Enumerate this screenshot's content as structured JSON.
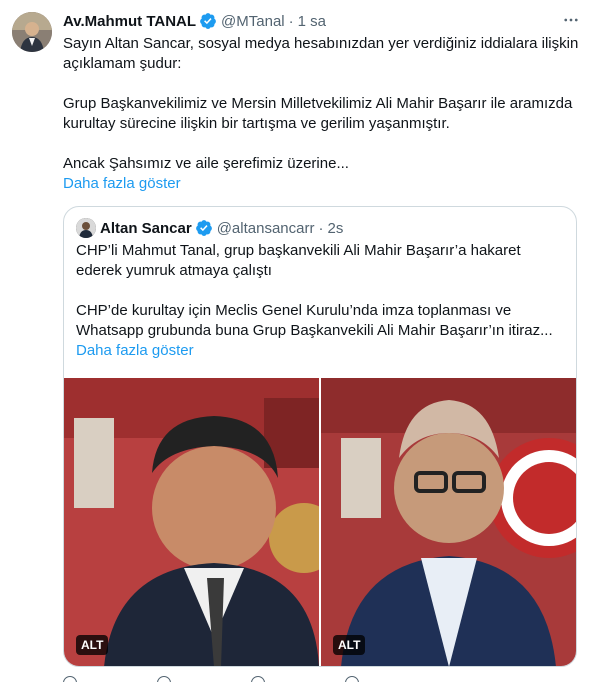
{
  "tweet": {
    "author_name": "Av.Mahmut TANAL",
    "handle": "@MTanal",
    "separator": "·",
    "time": "1 sa",
    "paragraphs": [
      "Sayın Altan Sancar, sosyal medya hesabınızdan yer verdiğiniz iddialara ilişkin açıklamam şudur:",
      "Grup Başkanvekilimiz ve Mersin Milletvekilimiz Ali Mahir Başarır ile aramızda kurultay sürecine ilişkin bir tartışma ve gerilim yaşanmıştır.",
      "Ancak Şahsımız ve aile şerefimiz üzerine..."
    ],
    "show_more": "Daha fazla göster",
    "more_icon": "more-horizontal-icon",
    "verified_color": "#1d9bf0"
  },
  "quote": {
    "author_name": "Altan Sancar",
    "handle": "@altansancarr",
    "separator": "·",
    "time": "2s",
    "paragraphs": [
      "CHP’li Mahmut Tanal, grup başkanvekili Ali Mahir Başarır’a hakaret ederek yumruk atmaya çalıştı",
      "CHP’de kurultay için Meclis Genel Kurulu’nda imza toplanması ve Whatsapp grubunda buna Grup Başkanvekili Ali Mahir Başarır’ın itiraz..."
    ],
    "show_more": "Daha fazla göster",
    "media": [
      {
        "alt_badge": "ALT"
      },
      {
        "alt_badge": "ALT"
      }
    ]
  },
  "colors": {
    "text": "#0f1419",
    "secondary": "#536471",
    "link": "#1d9bf0",
    "border": "#cfd9de"
  }
}
